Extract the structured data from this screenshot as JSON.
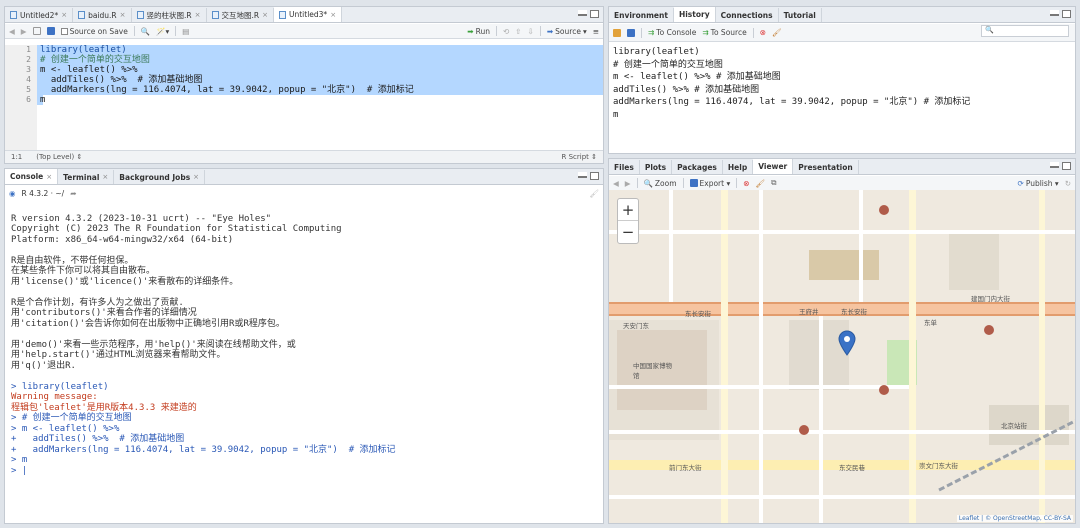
{
  "source_pane": {
    "tabs": [
      {
        "label": "Untitled2*",
        "active": false
      },
      {
        "label": "baidu.R",
        "active": false
      },
      {
        "label": "竖的柱状图.R",
        "active": false
      },
      {
        "label": "交互地图.R",
        "active": false
      },
      {
        "label": "Untitled3*",
        "active": true
      }
    ],
    "toolbar": {
      "source_on_save": "Source on Save",
      "run": "Run",
      "source": "Source"
    },
    "line_numbers": [
      "1",
      "2",
      "3",
      "4",
      "5",
      "6"
    ],
    "code_lines": [
      "library(leaflet)",
      "# 创建一个简单的交互地图",
      "m <- leaflet() %>%",
      "  addTiles() %>%  # 添加基础地图",
      "  addMarkers(lng = 116.4074, lat = 39.9042, popup = \"北京\")  # 添加标记",
      "m"
    ],
    "status": {
      "position": "1:1",
      "scope": "(Top Level) ⇕",
      "filetype": "R Script ⇕"
    }
  },
  "env_pane": {
    "tabs": [
      {
        "label": "Environment",
        "active": false
      },
      {
        "label": "History",
        "active": true
      },
      {
        "label": "Connections",
        "active": false
      },
      {
        "label": "Tutorial",
        "active": false
      }
    ],
    "toolbar": {
      "to_console": "To Console",
      "to_source": "To Source"
    },
    "history": [
      "library(leaflet)",
      "# 创建一个简单的交互地图",
      "m <- leaflet() %>% # 添加基础地图",
      "addTiles() %>% # 添加基础地图",
      "addMarkers(lng = 116.4074, lat = 39.9042, popup = \"北京\") # 添加标记",
      "m"
    ]
  },
  "console_pane": {
    "tabs": [
      {
        "label": "Console",
        "active": true
      },
      {
        "label": "Terminal",
        "active": false
      },
      {
        "label": "Background Jobs",
        "active": false
      }
    ],
    "path": "R 4.3.2 · ~/",
    "lines": [
      {
        "text": "",
        "cls": ""
      },
      {
        "text": "R version 4.3.2 (2023-10-31 ucrt) -- \"Eye Holes\"",
        "cls": ""
      },
      {
        "text": "Copyright (C) 2023 The R Foundation for Statistical Computing",
        "cls": ""
      },
      {
        "text": "Platform: x86_64-w64-mingw32/x64 (64-bit)",
        "cls": ""
      },
      {
        "text": "",
        "cls": ""
      },
      {
        "text": "R是自由软件，不带任何担保。",
        "cls": ""
      },
      {
        "text": "在某些条件下你可以将其自由散布。",
        "cls": ""
      },
      {
        "text": "用'license()'或'licence()'来看散布的详细条件。",
        "cls": ""
      },
      {
        "text": "",
        "cls": ""
      },
      {
        "text": "R是个合作计划，有许多人为之做出了贡献.",
        "cls": ""
      },
      {
        "text": "用'contributors()'来看合作者的详细情况",
        "cls": ""
      },
      {
        "text": "用'citation()'会告诉你如何在出版物中正确地引用R或R程序包。",
        "cls": ""
      },
      {
        "text": "",
        "cls": ""
      },
      {
        "text": "用'demo()'来看一些示范程序，用'help()'来阅读在线帮助文件，或",
        "cls": ""
      },
      {
        "text": "用'help.start()'通过HTML浏览器来看帮助文件。",
        "cls": ""
      },
      {
        "text": "用'q()'退出R.",
        "cls": ""
      },
      {
        "text": "",
        "cls": ""
      },
      {
        "text": "> library(leaflet)",
        "cls": "blue"
      },
      {
        "text": "Warning message:",
        "cls": "red"
      },
      {
        "text": "程辑包'leaflet'是用R版本4.3.3 来建造的",
        "cls": "red"
      },
      {
        "text": "> # 创建一个简单的交互地图",
        "cls": "blue"
      },
      {
        "text": "> m <- leaflet() %>%",
        "cls": "blue"
      },
      {
        "text": "+   addTiles() %>%  # 添加基础地图",
        "cls": "blue"
      },
      {
        "text": "+   addMarkers(lng = 116.4074, lat = 39.9042, popup = \"北京\")  # 添加标记",
        "cls": "blue"
      },
      {
        "text": "> m",
        "cls": "blue"
      },
      {
        "text": "> |",
        "cls": "blue"
      }
    ]
  },
  "viewer_pane": {
    "tabs": [
      {
        "label": "Files",
        "active": false
      },
      {
        "label": "Plots",
        "active": false
      },
      {
        "label": "Packages",
        "active": false
      },
      {
        "label": "Help",
        "active": false
      },
      {
        "label": "Viewer",
        "active": true
      },
      {
        "label": "Presentation",
        "active": false
      }
    ],
    "toolbar": {
      "zoom": "Zoom",
      "export": "Export ▾",
      "publish": "Publish ▾"
    },
    "map": {
      "zoom_in": "+",
      "zoom_out": "−",
      "attribution": "Leaflet | © OpenStreetMap, CC-BY-SA",
      "labels": {
        "east_chang_an": "东长安街",
        "chang_an": "东长安街",
        "jianguomen": "建国门内大街",
        "qianmen": "前门东大街",
        "museum": "中国国家博物馆",
        "dongjiaominxiang": "东交民巷",
        "beijingzhan": "北京站街",
        "chongwenmen": "崇文门东大街",
        "dongdan": "东单",
        "wangfujing": "王府井",
        "tiananmen": "天安门东"
      }
    }
  }
}
